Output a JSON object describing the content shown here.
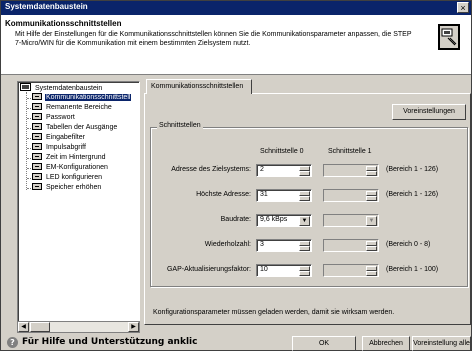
{
  "window": {
    "title": "Systemdatenbaustein",
    "close_label": "×"
  },
  "header": {
    "title": "Kommunikationsschnittstellen",
    "description": "Mit Hilfe der Einstellungen für die Kommunikationsschnittstellen können Sie die Kommunikationsparameter anpassen, die STEP 7-Micro/WIN für die Kommunikation mit einem bestimmten Zielsystem nutzt."
  },
  "tree": {
    "root": "Systemdatenbaustein",
    "items": [
      {
        "label": "Kommunikationsschnittstell",
        "selected": true
      },
      {
        "label": "Remanente Bereiche",
        "selected": false
      },
      {
        "label": "Passwort",
        "selected": false
      },
      {
        "label": "Tabellen der Ausgänge",
        "selected": false
      },
      {
        "label": "Eingabefilter",
        "selected": false
      },
      {
        "label": "Impulsabgriff",
        "selected": false
      },
      {
        "label": "Zeit im Hintergrund",
        "selected": false
      },
      {
        "label": "EM-Konfigurationen",
        "selected": false
      },
      {
        "label": "LED konfigurieren",
        "selected": false
      },
      {
        "label": "Speicher erhöhen",
        "selected": false
      }
    ],
    "scroll_left": "◀",
    "scroll_right": "▶"
  },
  "tab": {
    "label": "Kommunikationsschnittstellen"
  },
  "defaults_button": "Voreinstellungen",
  "group": {
    "legend": "Schnittstellen",
    "col0": "Schnittstelle 0",
    "col1": "Schnittstelle 1",
    "rows": [
      {
        "label": "Adresse des Zielsystems:",
        "port0": "2",
        "range": "(Bereich 1 - 126)"
      },
      {
        "label": "Höchste Adresse:",
        "port0": "31",
        "range": "(Bereich 1 - 126)"
      },
      {
        "label": "Baudrate:",
        "port0": "9,6 kBps",
        "range": ""
      },
      {
        "label": "Wiederholzahl:",
        "port0": "3",
        "range": "(Bereich 0 - 8)"
      },
      {
        "label": "GAP-Aktualisierungsfaktor:",
        "port0": "10",
        "range": "(Bereich 1 - 100)"
      }
    ]
  },
  "footnote": "Konfigurationsparameter müssen geladen werden, damit sie wirksam werden.",
  "footer": {
    "help_text": "Für Hilfe und Unterstützung anklic",
    "ok": "OK",
    "cancel": "Abbrechen",
    "defaults_all": "Voreinstellung alle"
  }
}
